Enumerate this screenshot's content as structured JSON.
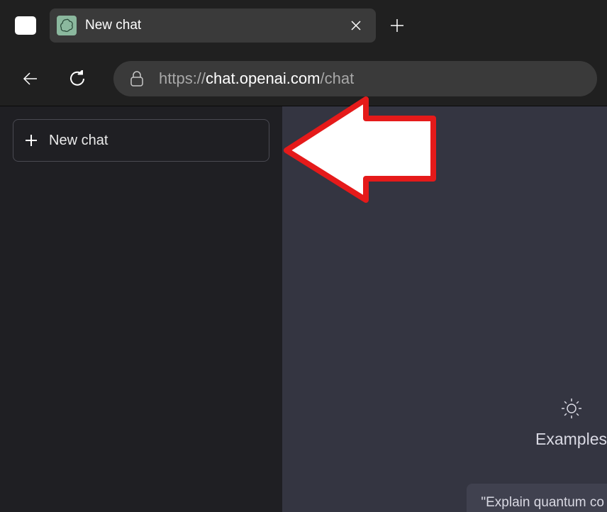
{
  "browser": {
    "tab": {
      "title": "New chat"
    },
    "url": {
      "protocol": "https://",
      "domain": "chat.openai.com",
      "path": "/chat"
    }
  },
  "sidebar": {
    "new_chat_label": "New chat"
  },
  "main": {
    "examples": {
      "heading": "Examples",
      "card1": "\"Explain quantum co"
    }
  }
}
